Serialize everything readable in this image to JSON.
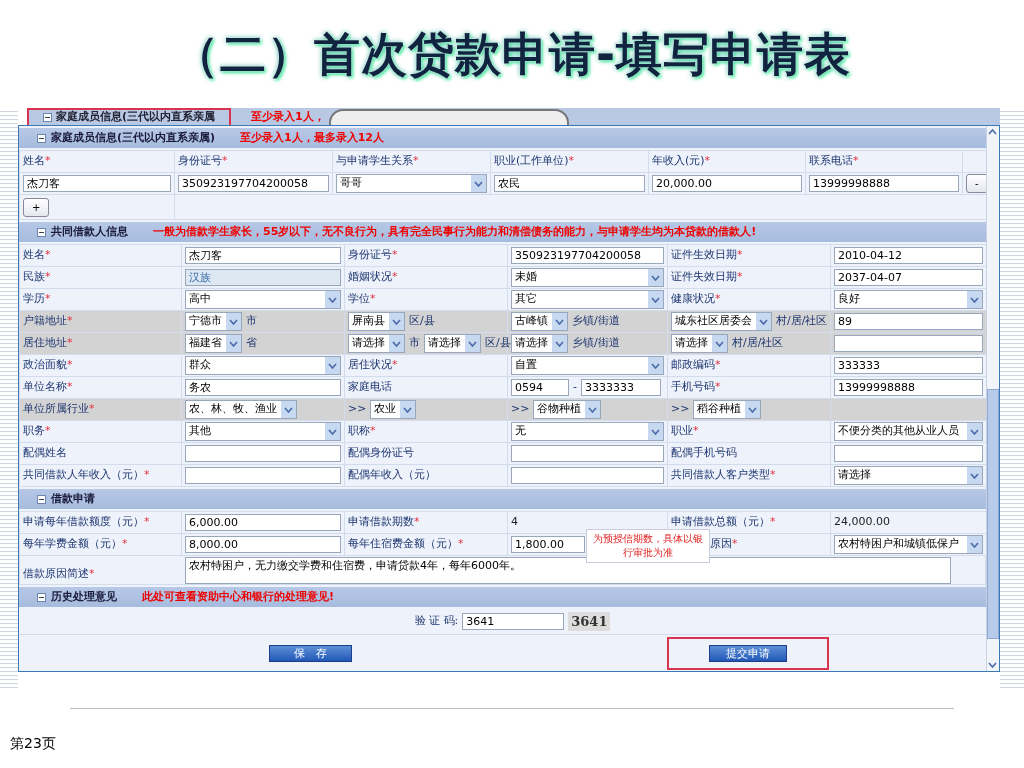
{
  "slide": {
    "title": "（二）首次贷款申请-填写申请表",
    "page": "第23页"
  },
  "back_header": {
    "title": "家庭成员信息(三代以内直系亲属",
    "note": "至少录入1人，"
  },
  "family": {
    "title": "家庭成员信息(三代以内直系亲属)",
    "note": "至少录入1人，最多录入12人",
    "columns": [
      {
        "label": "姓名",
        "req": "*"
      },
      {
        "label": "身份证号",
        "req": "*"
      },
      {
        "label": "与申请学生关系",
        "req": "*"
      },
      {
        "label": "职业(工作单位)",
        "req": "*"
      },
      {
        "label": "年收入(元)",
        "req": "*"
      },
      {
        "label": "联系电话",
        "req": "*"
      }
    ],
    "rows": [
      {
        "cells": [
          {
            "kind": "input",
            "value": "杰刀客"
          },
          {
            "kind": "input",
            "value": "350923197704200058"
          },
          {
            "kind": "select",
            "value": "哥哥"
          },
          {
            "kind": "input",
            "value": "农民"
          },
          {
            "kind": "input",
            "value": "20,000.00"
          },
          {
            "kind": "input",
            "value": "13999998888"
          }
        ],
        "remove": "-"
      }
    ],
    "add": "+"
  },
  "coborrower": {
    "title": "共同借款人信息",
    "note": "一般为借款学生家长，55岁以下，无不良行为，具有完全民事行为能力和清偿债务的能力，与申请学生均为本贷款的借款人!",
    "rows": [
      {
        "shaded": false,
        "cells": [
          {
            "kind": "label",
            "text": "姓名",
            "req": "*"
          },
          {
            "kind": "input",
            "value": "杰刀客"
          },
          {
            "kind": "label",
            "text": "身份证号",
            "req": "*"
          },
          {
            "kind": "input",
            "value": "350923197704200058"
          },
          {
            "kind": "label",
            "text": "证件生效日期",
            "req": "*"
          },
          {
            "kind": "input",
            "value": "2010-04-12"
          }
        ]
      },
      {
        "shaded": false,
        "cells": [
          {
            "kind": "label",
            "text": "民族",
            "req": "*"
          },
          {
            "kind": "readonly",
            "value": "汉族"
          },
          {
            "kind": "label",
            "text": "婚姻状况",
            "req": "*"
          },
          {
            "kind": "select",
            "value": "未婚"
          },
          {
            "kind": "label",
            "text": "证件失效日期",
            "req": "*"
          },
          {
            "kind": "input",
            "value": "2037-04-07"
          }
        ]
      },
      {
        "shaded": false,
        "cells": [
          {
            "kind": "label",
            "text": "学历",
            "req": "*"
          },
          {
            "kind": "select",
            "value": "高中"
          },
          {
            "kind": "label",
            "text": "学位",
            "req": "*"
          },
          {
            "kind": "select",
            "value": "其它"
          },
          {
            "kind": "label",
            "text": "健康状况",
            "req": "*"
          },
          {
            "kind": "select",
            "value": "良好"
          }
        ]
      },
      {
        "shaded": true,
        "cells": [
          {
            "kind": "label",
            "text": "户籍地址",
            "req": "*"
          },
          {
            "kind": "group",
            "items": [
              {
                "kind": "select",
                "value": "宁德市"
              },
              {
                "kind": "unit",
                "text": "市"
              }
            ]
          },
          {
            "kind": "group",
            "items": [
              {
                "kind": "select",
                "value": "屏南县"
              },
              {
                "kind": "unit",
                "text": "区/县"
              }
            ]
          },
          {
            "kind": "group",
            "items": [
              {
                "kind": "select",
                "value": "古峰镇"
              },
              {
                "kind": "unit",
                "text": "乡镇/街道"
              }
            ]
          },
          {
            "kind": "group",
            "items": [
              {
                "kind": "select",
                "value": "城东社区居委会"
              },
              {
                "kind": "unit",
                "text": "村/居/社区"
              }
            ]
          },
          {
            "kind": "input",
            "value": "89"
          }
        ]
      },
      {
        "shaded": true,
        "cells": [
          {
            "kind": "label",
            "text": "居住地址",
            "req": "*"
          },
          {
            "kind": "group",
            "items": [
              {
                "kind": "select",
                "value": "福建省"
              },
              {
                "kind": "unit",
                "text": "省"
              }
            ]
          },
          {
            "kind": "group",
            "items": [
              {
                "kind": "select",
                "value": "请选择"
              },
              {
                "kind": "unit",
                "text": "市"
              },
              {
                "kind": "select",
                "value": "请选择"
              },
              {
                "kind": "unit",
                "text": "区/县"
              }
            ]
          },
          {
            "kind": "group",
            "items": [
              {
                "kind": "select",
                "value": "请选择"
              },
              {
                "kind": "unit",
                "text": "乡镇/街道"
              }
            ]
          },
          {
            "kind": "group",
            "items": [
              {
                "kind": "select",
                "value": "请选择"
              },
              {
                "kind": "unit",
                "text": "村/居/社区"
              }
            ]
          },
          {
            "kind": "input"
          }
        ]
      },
      {
        "shaded": false,
        "cells": [
          {
            "kind": "label",
            "text": "政治面貌",
            "req": "*"
          },
          {
            "kind": "select",
            "value": "群众"
          },
          {
            "kind": "label",
            "text": "居住状况",
            "req": "*"
          },
          {
            "kind": "select",
            "value": "自置"
          },
          {
            "kind": "label",
            "text": "邮政编码",
            "req": "*"
          },
          {
            "kind": "input",
            "value": "333333"
          }
        ]
      },
      {
        "shaded": false,
        "cells": [
          {
            "kind": "label",
            "text": "单位名称",
            "req": "*"
          },
          {
            "kind": "input",
            "value": "务农"
          },
          {
            "kind": "label",
            "text": "家庭电话"
          },
          {
            "kind": "group",
            "items": [
              {
                "kind": "input",
                "value": "0594"
              },
              {
                "kind": "unit",
                "text": "-"
              },
              {
                "kind": "input",
                "value": "3333333"
              }
            ]
          },
          {
            "kind": "label",
            "text": "手机号码",
            "req": "*"
          },
          {
            "kind": "input",
            "value": "13999998888"
          }
        ]
      },
      {
        "shaded": true,
        "cells": [
          {
            "kind": "label",
            "text": "单位所属行业",
            "req": "*"
          },
          {
            "kind": "group",
            "items": [
              {
                "kind": "select",
                "value": "农、林、牧、渔业"
              }
            ]
          },
          {
            "kind": "group",
            "items": [
              {
                "kind": "unit",
                "text": ">>"
              },
              {
                "kind": "select",
                "value": "农业"
              }
            ]
          },
          {
            "kind": "group",
            "items": [
              {
                "kind": "unit",
                "text": ">>"
              },
              {
                "kind": "select",
                "value": "谷物种植"
              }
            ]
          },
          {
            "kind": "group",
            "items": [
              {
                "kind": "unit",
                "text": ">>"
              },
              {
                "kind": "select",
                "value": "稻谷种植"
              }
            ]
          },
          {
            "kind": "blank"
          }
        ]
      },
      {
        "shaded": false,
        "cells": [
          {
            "kind": "label",
            "text": "职务",
            "req": "*"
          },
          {
            "kind": "select",
            "value": "其他"
          },
          {
            "kind": "label",
            "text": "职称",
            "req": "*"
          },
          {
            "kind": "select",
            "value": "无"
          },
          {
            "kind": "label",
            "text": "职业",
            "req": "*"
          },
          {
            "kind": "select",
            "value": "不便分类的其他从业人员"
          }
        ]
      },
      {
        "shaded": false,
        "cells": [
          {
            "kind": "label",
            "text": "配偶姓名"
          },
          {
            "kind": "input"
          },
          {
            "kind": "label",
            "text": "配偶身份证号"
          },
          {
            "kind": "input"
          },
          {
            "kind": "label",
            "text": "配偶手机号码"
          },
          {
            "kind": "input"
          }
        ]
      },
      {
        "shaded": false,
        "cells": [
          {
            "kind": "label",
            "text": "共同借款人年收入（元）",
            "req": "*"
          },
          {
            "kind": "input"
          },
          {
            "kind": "label",
            "text": "配偶年收入（元）"
          },
          {
            "kind": "input"
          },
          {
            "kind": "label",
            "text": "共同借款人客户类型",
            "req": "*"
          },
          {
            "kind": "select",
            "value": "请选择"
          }
        ]
      }
    ]
  },
  "loan": {
    "title": "借款申请",
    "rows": [
      {
        "shaded": false,
        "cells": [
          {
            "kind": "label",
            "text": "申请每年借款额度（元）",
            "req": "*"
          },
          {
            "kind": "input",
            "value": "6,000.00"
          },
          {
            "kind": "label",
            "text": "申请借款期数",
            "req": "*"
          },
          {
            "kind": "text",
            "value": "4"
          },
          {
            "kind": "label",
            "text": "申请借款总额（元）",
            "req": "*"
          },
          {
            "kind": "text",
            "value": "24,000.00"
          }
        ]
      },
      {
        "shaded": false,
        "cells": [
          {
            "kind": "label",
            "text": "每年学费金额（元）",
            "req": "*"
          },
          {
            "kind": "input",
            "value": "8,000.00"
          },
          {
            "kind": "label",
            "text": "每年住宿费金额（元）",
            "req": "*"
          },
          {
            "kind": "input",
            "value": "1,800.00",
            "tooltip": "为预授信期数，具体以银行审批为准"
          },
          {
            "kind": "label",
            "text": "原因",
            "req": "*",
            "cut": true
          },
          {
            "kind": "select",
            "value": "农村特困户和城镇低保户"
          }
        ]
      }
    ],
    "reason": {
      "label": "借款原因简述",
      "req": "*",
      "value": "农村特困户，无力缴交学费和住宿费，申请贷款4年，每年6000年。"
    }
  },
  "history": {
    "title": "历史处理意见",
    "note": "此处可查看资助中心和银行的处理意见!"
  },
  "captcha": {
    "label": "验 证 码:",
    "value": "3641",
    "image_text": "3641"
  },
  "buttons": [
    {
      "kind": "save",
      "label": "保　存",
      "highlighted": false
    },
    {
      "kind": "submit",
      "label": "提交申请",
      "highlighted": true
    }
  ]
}
